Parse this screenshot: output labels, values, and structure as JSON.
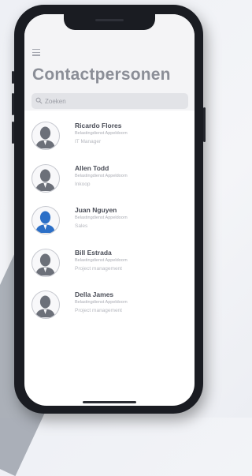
{
  "app": {
    "title": "Contactpersonen"
  },
  "search": {
    "placeholder": "Zoeken",
    "value": ""
  },
  "icons": {
    "menu": "hamburger-menu-icon",
    "search": "search-icon",
    "avatar": "person-avatar-icon"
  },
  "colors": {
    "avatar_default": "#6c7079",
    "avatar_highlight": "#2b6fc7",
    "title": "#8b8e97",
    "name": "#4a4d57",
    "subtitle": "#a9abb3"
  },
  "contacts": [
    {
      "name": "Ricardo Flores",
      "company": "Belastingdienst Appeldoorn",
      "role": "IT Manager",
      "highlighted": false
    },
    {
      "name": "Allen Todd",
      "company": "Belastingdienst Appeldoorn",
      "role": "Inkoop",
      "highlighted": false
    },
    {
      "name": "Juan Nguyen",
      "company": "Belastingdienst Appeldoorn",
      "role": "Sales",
      "highlighted": true
    },
    {
      "name": "Bill Estrada",
      "company": "Belastingdienst Appeldoorn",
      "role": "Project management",
      "highlighted": false
    },
    {
      "name": "Della James",
      "company": "Belastingdienst Appeldoorn",
      "role": "Project management",
      "highlighted": false
    }
  ]
}
